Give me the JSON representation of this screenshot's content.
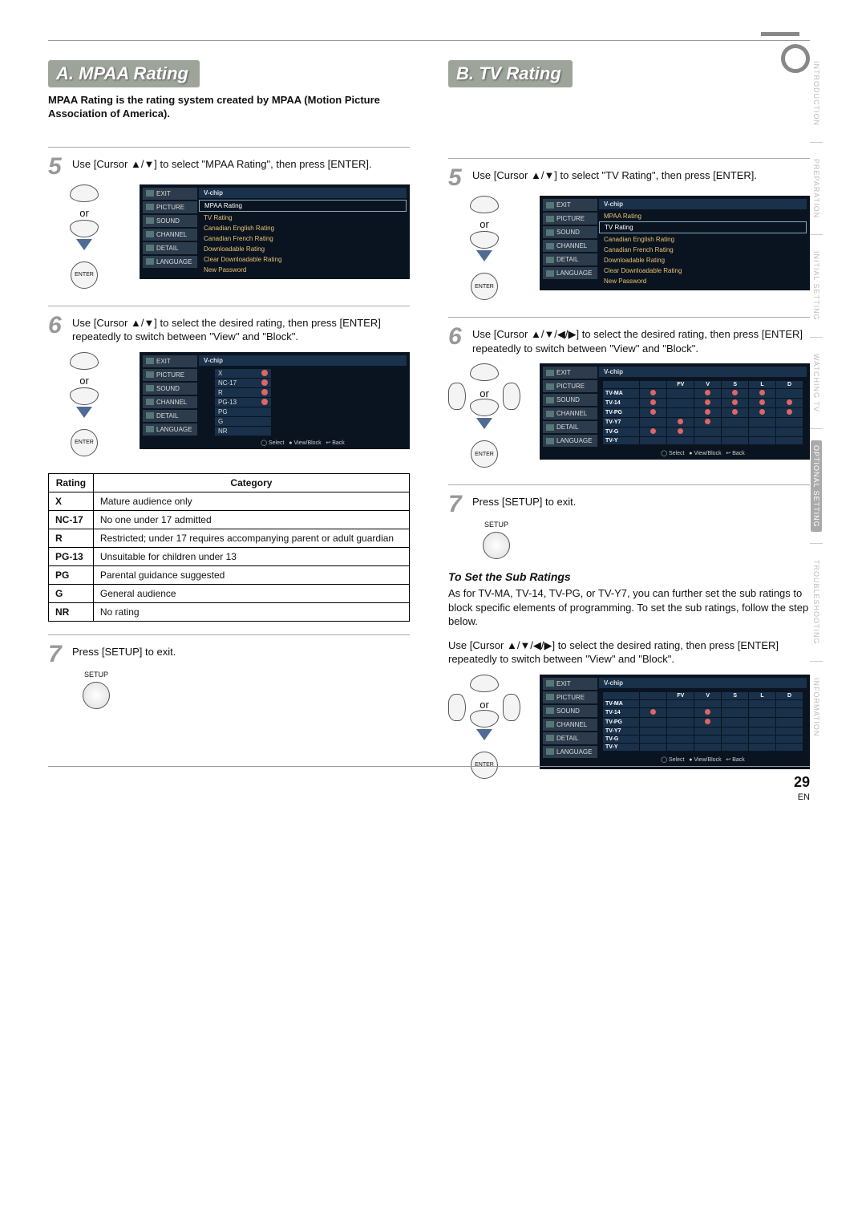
{
  "headings": {
    "a": "A.  MPAA Rating",
    "b": "B.  TV Rating"
  },
  "intro_a": "MPAA Rating is the rating system created by MPAA (Motion Picture Association of America).",
  "steps_a": {
    "s5": "Use [Cursor ▲/▼] to select \"MPAA Rating\", then press [ENTER].",
    "s6": "Use [Cursor ▲/▼] to select the desired rating, then press [ENTER] repeatedly to switch between \"View\" and \"Block\".",
    "s7": "Press [SETUP] to exit."
  },
  "steps_b": {
    "s5": "Use [Cursor ▲/▼] to select \"TV Rating\", then press [ENTER].",
    "s6": "Use [Cursor ▲/▼/◀/▶] to select the desired rating, then press [ENTER] repeatedly to switch between \"View\" and \"Block\".",
    "s7": "Press [SETUP] to exit."
  },
  "remote": {
    "or": "or",
    "enter": "ENTER",
    "setup_label": "SETUP"
  },
  "osd_nav": [
    "EXIT",
    "PICTURE",
    "SOUND",
    "CHANNEL",
    "DETAIL",
    "LANGUAGE"
  ],
  "osd_title": "V-chip",
  "osd_menu_items": [
    "MPAA Rating",
    "TV Rating",
    "Canadian English Rating",
    "Canadian French Rating",
    "Downloadable Rating",
    "Clear Downloadable Rating",
    "New Password"
  ],
  "osd_mpaa_list": [
    "X",
    "NC-17",
    "R",
    "PG-13",
    "PG",
    "G",
    "NR"
  ],
  "osd_mpaa_blocked": [
    "X",
    "NC-17",
    "R",
    "PG-13"
  ],
  "osd_footer": {
    "select": "Select",
    "viewblock": "View/Block",
    "back": "Back"
  },
  "tv_grid": {
    "cols": [
      "FV",
      "V",
      "S",
      "L",
      "D"
    ],
    "rows": [
      "TV-MA",
      "TV-14",
      "TV-PG",
      "TV-Y7",
      "TV-G",
      "TV-Y"
    ],
    "matrix_a": {
      "TV-MA": [
        null,
        true,
        true,
        true,
        null
      ],
      "TV-14": [
        null,
        true,
        true,
        true,
        true
      ],
      "TV-PG": [
        null,
        true,
        true,
        true,
        true
      ],
      "TV-Y7": [
        true,
        true,
        null,
        null,
        null
      ],
      "TV-G": [
        true,
        null,
        null,
        null,
        null
      ],
      "TV-Y": [
        null,
        null,
        null,
        null,
        null
      ]
    },
    "row_block_a": {
      "TV-MA": true,
      "TV-14": true,
      "TV-PG": true,
      "TV-Y7": null,
      "TV-G": true,
      "TV-Y": null
    },
    "matrix_b": {
      "TV-MA": [
        null,
        null,
        null,
        null,
        null
      ],
      "TV-14": [
        null,
        true,
        null,
        null,
        null
      ],
      "TV-PG": [
        null,
        true,
        null,
        null,
        null
      ],
      "TV-Y7": [
        null,
        null,
        null,
        null,
        null
      ],
      "TV-G": [
        null,
        null,
        null,
        null,
        null
      ],
      "TV-Y": [
        null,
        null,
        null,
        null,
        null
      ]
    },
    "row_block_b": {
      "TV-MA": null,
      "TV-14": true,
      "TV-PG": null,
      "TV-Y7": null,
      "TV-G": null,
      "TV-Y": null
    }
  },
  "mpaa_table": {
    "headers": {
      "rating": "Rating",
      "category": "Category"
    },
    "rows": [
      {
        "r": "X",
        "c": "Mature audience only"
      },
      {
        "r": "NC-17",
        "c": "No one under 17 admitted"
      },
      {
        "r": "R",
        "c": "Restricted; under 17 requires accompanying parent or adult guardian"
      },
      {
        "r": "PG-13",
        "c": "Unsuitable for children under 13"
      },
      {
        "r": "PG",
        "c": "Parental guidance suggested"
      },
      {
        "r": "G",
        "c": "General audience"
      },
      {
        "r": "NR",
        "c": "No rating"
      }
    ]
  },
  "sub": {
    "heading": "To Set the Sub Ratings",
    "p1": "As for TV-MA, TV-14, TV-PG, or TV-Y7, you can further set the sub ratings to block specific elements of programming. To set the sub ratings, follow the step below.",
    "p2": "Use [Cursor ▲/▼/◀/▶] to select the desired rating, then press [ENTER] repeatedly to switch between \"View\" and \"Block\"."
  },
  "tabs": [
    "INTRODUCTION",
    "PREPARATION",
    "INITIAL SETTING",
    "WATCHING TV",
    "OPTIONAL SETTING",
    "TROUBLESHOOTING",
    "INFORMATION"
  ],
  "tabs_active": "OPTIONAL SETTING",
  "page": {
    "num": "29",
    "lang": "EN"
  }
}
